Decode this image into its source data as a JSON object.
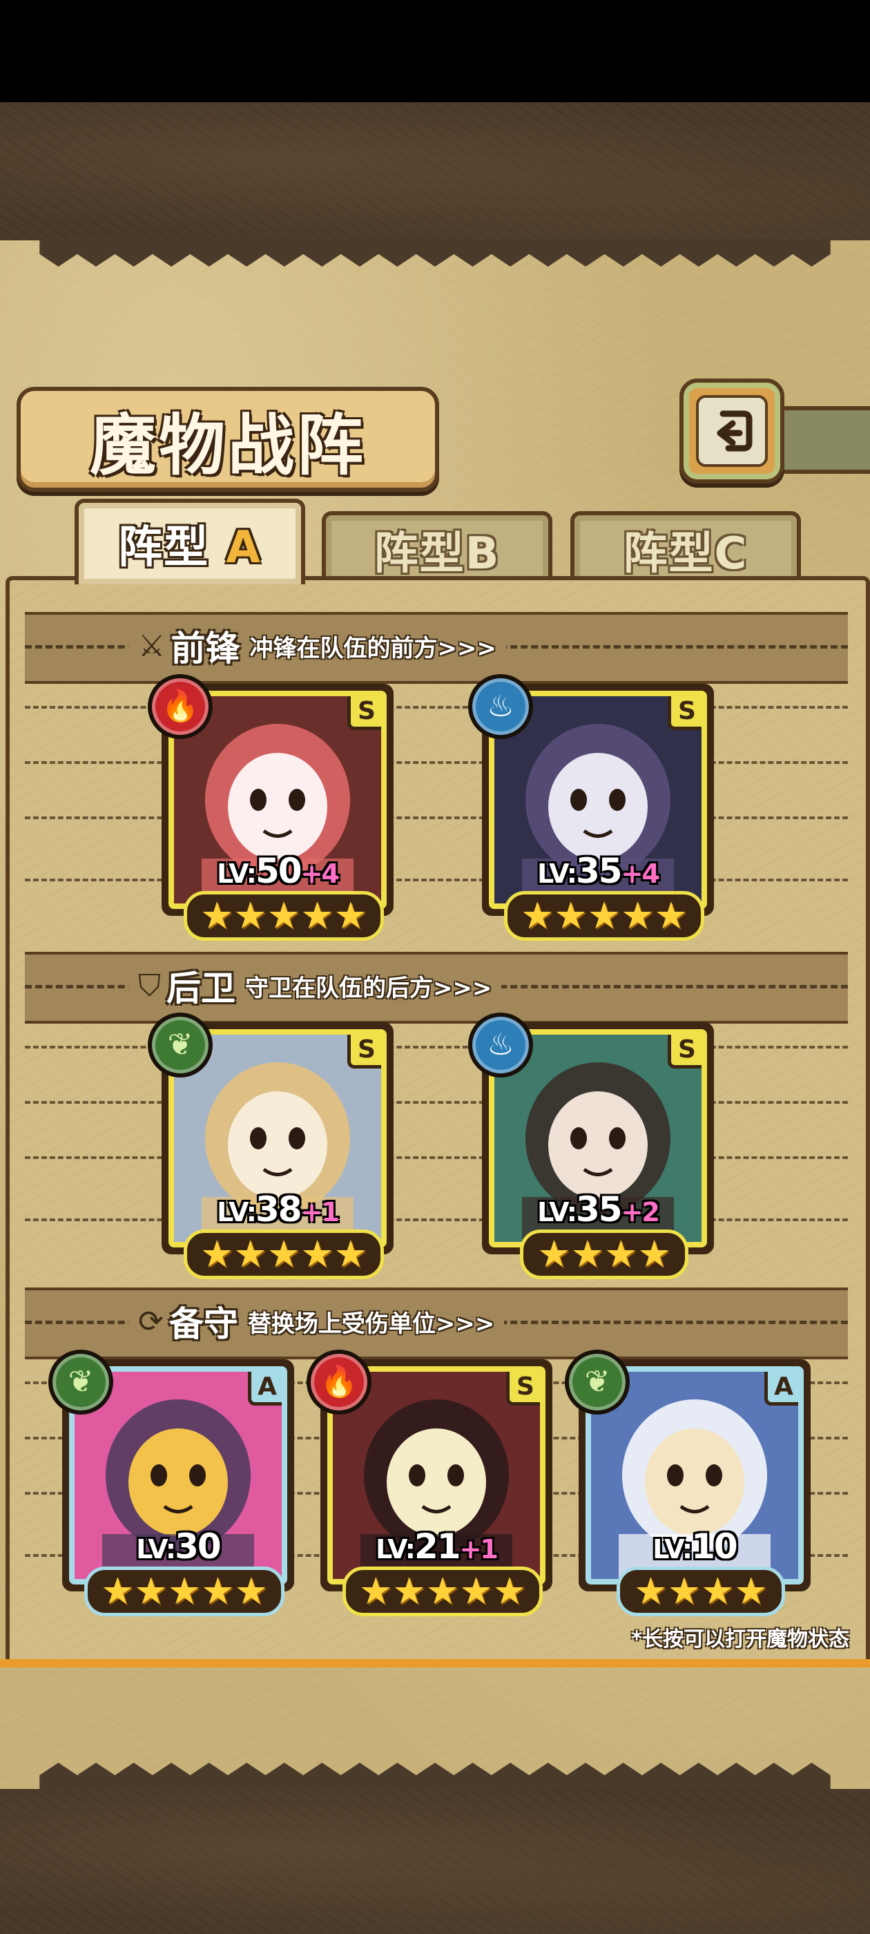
{
  "title": "魔物战阵",
  "back_icon": "back-arrow-icon",
  "tabs": [
    {
      "label": "阵型",
      "letter": "A",
      "active": true
    },
    {
      "label": "阵型",
      "letter": "B",
      "active": false
    },
    {
      "label": "阵型",
      "letter": "C",
      "active": false
    }
  ],
  "sections": [
    {
      "title": "前锋",
      "desc": "冲锋在队伍的前方>>>",
      "icon": "sword-icon"
    },
    {
      "title": "后卫",
      "desc": "守卫在队伍的后方>>>",
      "icon": "shield-icon"
    },
    {
      "title": "备守",
      "desc": "替换场上受伤单位>>>",
      "icon": "swap-icon"
    }
  ],
  "monsters": [
    {
      "level": "50",
      "plus": "+4",
      "rank": "S",
      "element": "fire",
      "stars": 5
    },
    {
      "level": "35",
      "plus": "+4",
      "rank": "S",
      "element": "water",
      "stars": 5
    },
    {
      "level": "38",
      "plus": "+1",
      "rank": "S",
      "element": "wood",
      "stars": 5
    },
    {
      "level": "35",
      "plus": "+2",
      "rank": "S",
      "element": "water",
      "stars": 4
    },
    {
      "level": "30",
      "plus": "",
      "rank": "A",
      "element": "wood",
      "stars": 5
    },
    {
      "level": "21",
      "plus": "+1",
      "rank": "S",
      "element": "fire",
      "stars": 5
    },
    {
      "level": "10",
      "plus": "",
      "rank": "A",
      "element": "wood",
      "stars": 4
    }
  ],
  "lv_prefix": "LV:",
  "hint": "*长按可以打开魔物状态",
  "colors": {
    "rank_S": "#f0e04a",
    "rank_A": "#a6dbe8",
    "fire": "#c9262b",
    "water": "#2e7fb8",
    "wood": "#3f7a34"
  }
}
